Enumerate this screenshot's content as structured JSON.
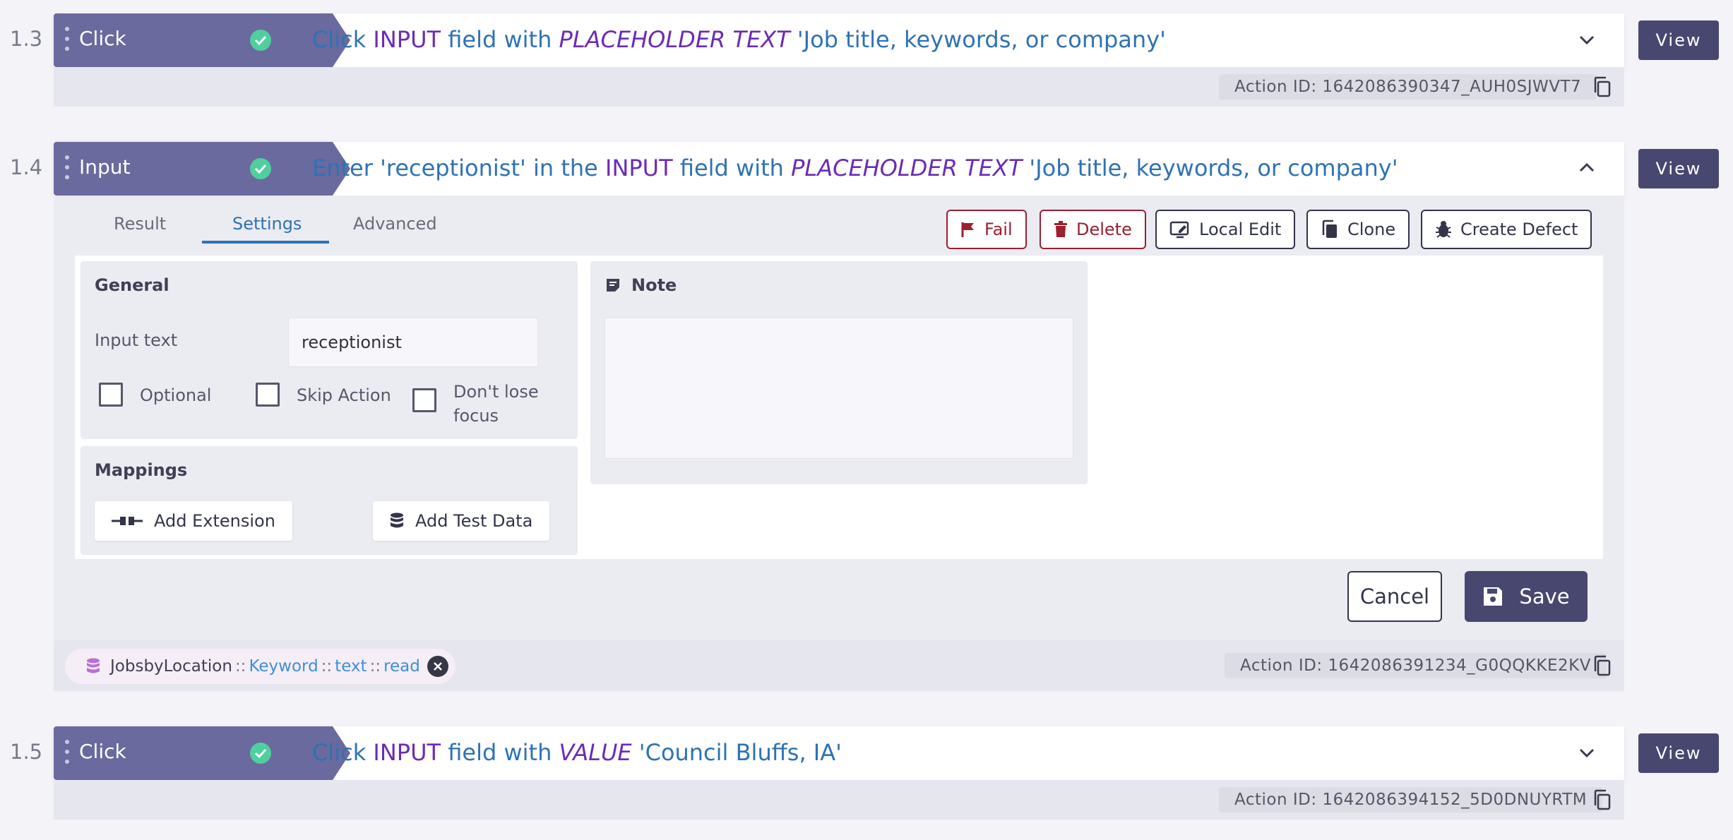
{
  "steps": [
    {
      "number": "1.3",
      "type": "Click",
      "description": {
        "pre": "Click ",
        "element": "INPUT",
        "mid": " field with ",
        "attr": "PLACEHOLDER TEXT",
        "value": " 'Job title, keywords, or company'"
      },
      "view_label": "View",
      "action_id": "Action ID: 1642086390347_AUH0SJWVT7"
    },
    {
      "number": "1.4",
      "type": "Input",
      "description": {
        "pre": "Enter 'receptionist' in the ",
        "element": "INPUT",
        "mid": " field with ",
        "attr": "PLACEHOLDER TEXT",
        "value": " 'Job title, keywords, or company'"
      },
      "view_label": "View",
      "action_id": "Action ID: 1642086391234_G0QQKKE2KV"
    },
    {
      "number": "1.5",
      "type": "Click",
      "description": {
        "pre": "Click ",
        "element": "INPUT",
        "mid": " field with ",
        "attr": "VALUE",
        "value": " 'Council Bluffs, IA'"
      },
      "view_label": "View",
      "action_id": "Action ID: 1642086394152_5D0DNUYRTM"
    }
  ],
  "panel": {
    "tabs": [
      "Result",
      "Settings",
      "Advanced"
    ],
    "active_tab": "Settings",
    "actions": {
      "fail": "Fail",
      "delete": "Delete",
      "local_edit": "Local Edit",
      "clone": "Clone",
      "create_defect": "Create Defect"
    },
    "general": {
      "title": "General",
      "input_label": "Input text",
      "input_value": "receptionist",
      "optional_label": "Optional",
      "skip_label": "Skip Action",
      "focus_label_1": "Don't lose",
      "focus_label_2": "focus"
    },
    "note": {
      "title": "Note",
      "value": ""
    },
    "mappings": {
      "title": "Mappings",
      "add_extension": "Add Extension",
      "add_test_data": "Add Test Data"
    },
    "cancel_label": "Cancel",
    "save_label": "Save"
  },
  "mapping_chip": {
    "source": "JobsbyLocation",
    "sep1": "::",
    "field": "Keyword",
    "sep2": "::",
    "type": "text",
    "sep3": "::",
    "mode": "read"
  },
  "colors": {
    "accent_purple": "#6a6a9e",
    "button_dark": "#474770",
    "success_green": "#4fcf9d",
    "link_blue": "#2e72b6",
    "danger_red": "#9b2030"
  }
}
